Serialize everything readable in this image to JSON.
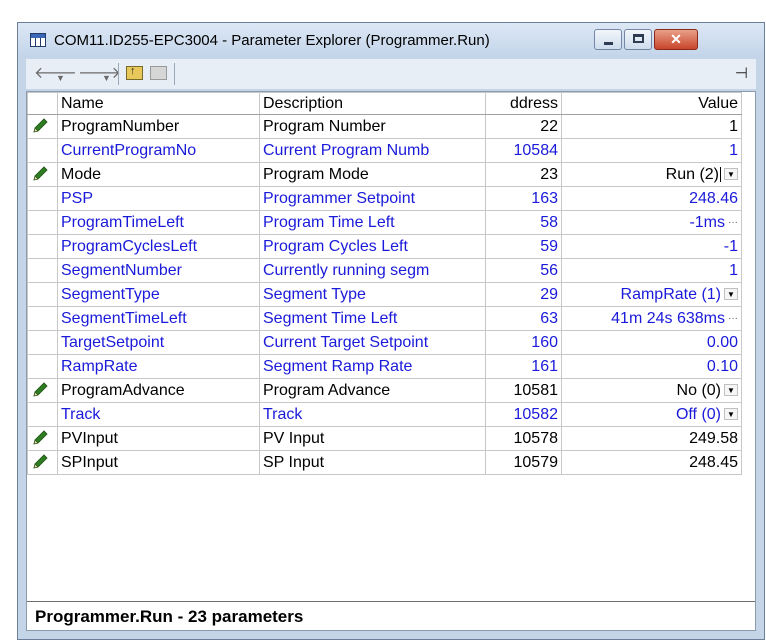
{
  "window": {
    "title": "COM11.ID255-EPC3004 - Parameter Explorer (Programmer.Run)",
    "close_glyph": "✕"
  },
  "toolbar": {
    "back_glyph": "🡐",
    "forward_glyph": "🡒",
    "dropdown_glyph": "▼",
    "up_glyph": "↑",
    "pin_glyph": "⊣"
  },
  "table": {
    "headers": {
      "name": "Name",
      "description": "Description",
      "address": "ddress",
      "value": "Value"
    },
    "rows": [
      {
        "writable": true,
        "color": "black",
        "name": "ProgramNumber",
        "description": "Program Number",
        "address": "22",
        "value": "1",
        "control": ""
      },
      {
        "writable": false,
        "color": "blue",
        "name": "CurrentProgramNo",
        "description": "Current Program Numb",
        "address": "10584",
        "value": "1",
        "control": ""
      },
      {
        "writable": true,
        "color": "black",
        "name": "Mode",
        "description": "Program Mode",
        "address": "23",
        "value": "Run (2)",
        "control": "dropdown-caret"
      },
      {
        "writable": false,
        "color": "blue",
        "name": "PSP",
        "description": "Programmer Setpoint",
        "address": "163",
        "value": "248.46",
        "control": ""
      },
      {
        "writable": false,
        "color": "blue",
        "name": "ProgramTimeLeft",
        "description": "Program Time Left",
        "address": "58",
        "value": "-1ms",
        "control": "ellipsis"
      },
      {
        "writable": false,
        "color": "blue",
        "name": "ProgramCyclesLeft",
        "description": "Program Cycles Left",
        "address": "59",
        "value": "-1",
        "control": ""
      },
      {
        "writable": false,
        "color": "blue",
        "name": "SegmentNumber",
        "description": "Currently running segm",
        "address": "56",
        "value": "1",
        "control": ""
      },
      {
        "writable": false,
        "color": "blue",
        "name": "SegmentType",
        "description": "Segment Type",
        "address": "29",
        "value": "RampRate (1)",
        "control": "dropdown"
      },
      {
        "writable": false,
        "color": "blue",
        "name": "SegmentTimeLeft",
        "description": "Segment Time Left",
        "address": "63",
        "value": "41m 24s 638ms",
        "control": "ellipsis"
      },
      {
        "writable": false,
        "color": "blue",
        "name": "TargetSetpoint",
        "description": "Current Target Setpoint",
        "address": "160",
        "value": "0.00",
        "control": ""
      },
      {
        "writable": false,
        "color": "blue",
        "name": "RampRate",
        "description": "Segment Ramp Rate",
        "address": "161",
        "value": "0.10",
        "control": ""
      },
      {
        "writable": true,
        "color": "black",
        "name": "ProgramAdvance",
        "description": "Program Advance",
        "address": "10581",
        "value": "No (0)",
        "control": "dropdown"
      },
      {
        "writable": false,
        "color": "blue",
        "name": "Track",
        "description": "Track",
        "address": "10582",
        "value": "Off (0)",
        "control": "dropdown"
      },
      {
        "writable": true,
        "color": "black",
        "name": "PVInput",
        "description": "PV Input",
        "address": "10578",
        "value": "249.58",
        "control": ""
      },
      {
        "writable": true,
        "color": "black",
        "name": "SPInput",
        "description": "SP Input",
        "address": "10579",
        "value": "248.45",
        "control": ""
      }
    ]
  },
  "status": {
    "text": "Programmer.Run  -  23 parameters"
  },
  "colors": {
    "writable_text": "#000000",
    "readonly_text": "#1a1adb",
    "pencil": "#2e7d1e"
  }
}
